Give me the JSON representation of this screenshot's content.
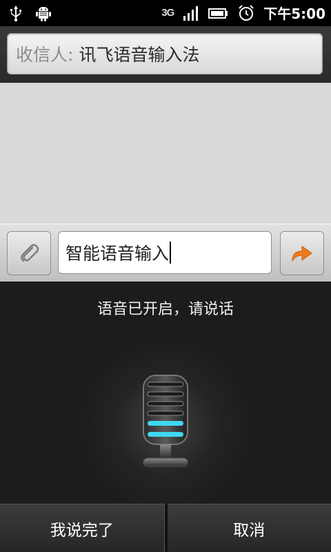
{
  "status_bar": {
    "network_type": "3G",
    "time": "下午5:00",
    "icons": [
      "usb-icon",
      "android-debug-icon",
      "signal-icon",
      "battery-icon",
      "alarm-icon"
    ]
  },
  "header": {
    "recipient_label": "收信人:",
    "recipient_value": "讯飞语音输入法"
  },
  "compose": {
    "text": "智能语音输入",
    "attach_icon": "paperclip-icon",
    "send_icon": "send-arrow-icon"
  },
  "voice": {
    "status_text": "语音已开启，请说话",
    "mic_icon": "microphone-icon"
  },
  "buttons": {
    "done_label": "我说完了",
    "cancel_label": "取消"
  },
  "colors": {
    "accent_orange": "#f07a1a",
    "mic_level_cyan": "#3fd8f0"
  }
}
